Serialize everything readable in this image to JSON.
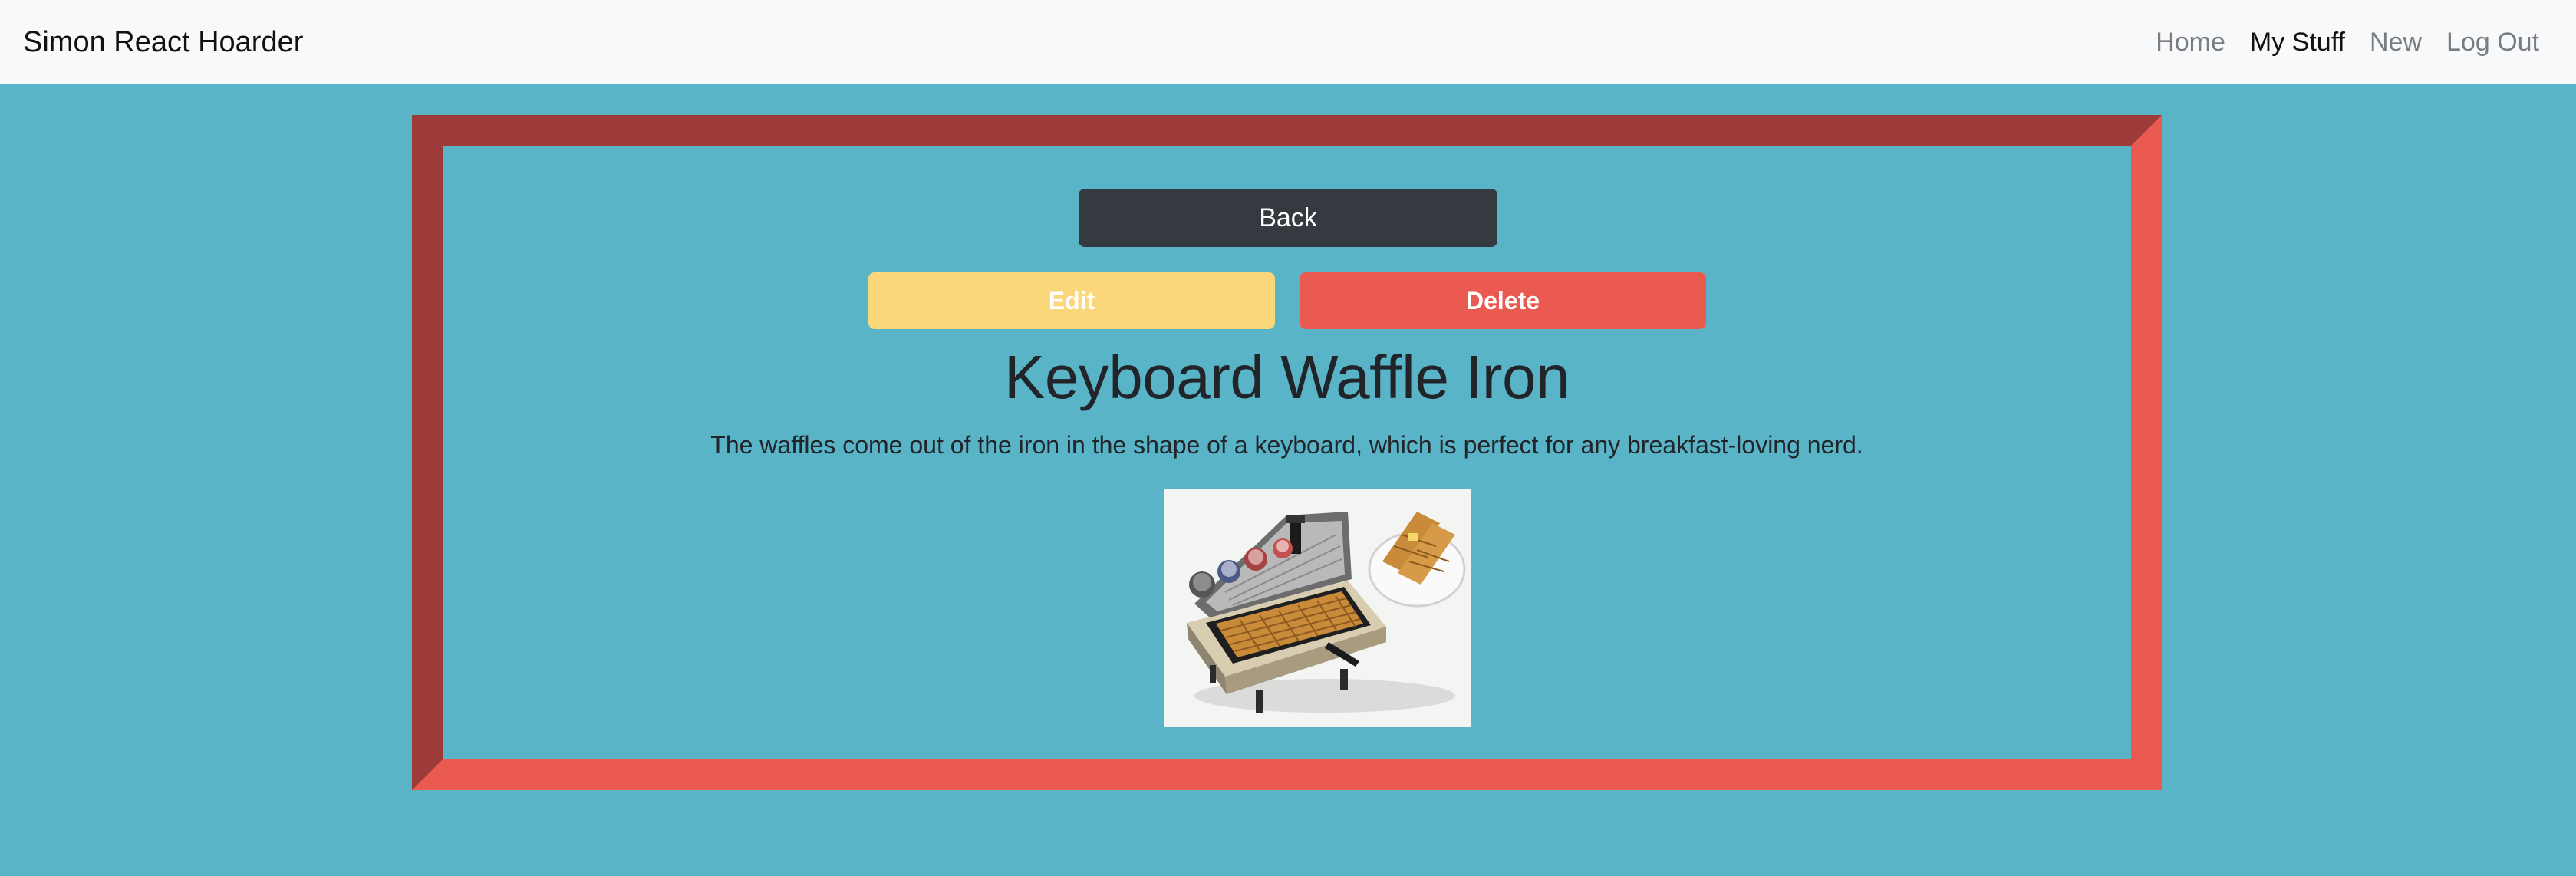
{
  "navbar": {
    "brand": "Simon React Hoarder",
    "links": [
      {
        "label": "Home",
        "active": false
      },
      {
        "label": "My Stuff",
        "active": true
      },
      {
        "label": "New",
        "active": false
      },
      {
        "label": "Log Out",
        "active": false
      }
    ]
  },
  "item": {
    "back_label": "Back",
    "edit_label": "Edit",
    "delete_label": "Delete",
    "title": "Keyboard Waffle Iron",
    "description": "The waffles come out of the iron in the shape of a keyboard, which is perfect for any breakfast-loving nerd."
  },
  "colors": {
    "page_background": "#5ab4c8",
    "navbar_background": "#f8f9fa",
    "frame_dark": "#9c3b3a",
    "frame_light": "#eb5a51",
    "back_button": "#343a40",
    "edit_button": "#f9d77a",
    "delete_button": "#eb5a51"
  }
}
